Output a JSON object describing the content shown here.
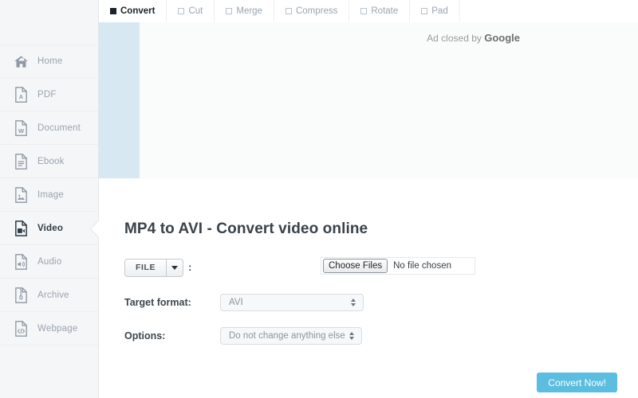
{
  "sidebar": {
    "items": [
      {
        "label": "Home",
        "icon": "home-icon",
        "active": false
      },
      {
        "label": "PDF",
        "icon": "pdf-file-icon",
        "active": false
      },
      {
        "label": "Document",
        "icon": "word-file-icon",
        "active": false
      },
      {
        "label": "Ebook",
        "icon": "ebook-file-icon",
        "active": false
      },
      {
        "label": "Image",
        "icon": "image-file-icon",
        "active": false
      },
      {
        "label": "Video",
        "icon": "video-file-icon",
        "active": true
      },
      {
        "label": "Audio",
        "icon": "audio-file-icon",
        "active": false
      },
      {
        "label": "Archive",
        "icon": "archive-file-icon",
        "active": false
      },
      {
        "label": "Webpage",
        "icon": "code-file-icon",
        "active": false
      }
    ]
  },
  "tabs": [
    {
      "label": "Convert",
      "active": true
    },
    {
      "label": "Cut",
      "active": false
    },
    {
      "label": "Merge",
      "active": false
    },
    {
      "label": "Compress",
      "active": false
    },
    {
      "label": "Rotate",
      "active": false
    },
    {
      "label": "Pad",
      "active": false
    }
  ],
  "ad": {
    "closed_prefix": "Ad closed by ",
    "closed_brand": "Google"
  },
  "main": {
    "title": "MP4 to AVI - Convert video online",
    "file_row": {
      "source_label": "FILE",
      "caret": "chevron-down-icon",
      "separator": ":",
      "choose_button": "Choose Files",
      "file_status": "No file chosen"
    },
    "target_format": {
      "label": "Target format:",
      "value": "AVI"
    },
    "options": {
      "label": "Options:",
      "value": "Do not change anything else"
    },
    "convert_button": "Convert Now!"
  },
  "colors": {
    "accent": "#5bbde0",
    "sidebar_bg": "#f5f6f7",
    "ad_bg": "#fafbfb",
    "ad_block": "#d8e8f3",
    "muted_text": "#9aa4b0",
    "active_text": "#2e3a45"
  }
}
